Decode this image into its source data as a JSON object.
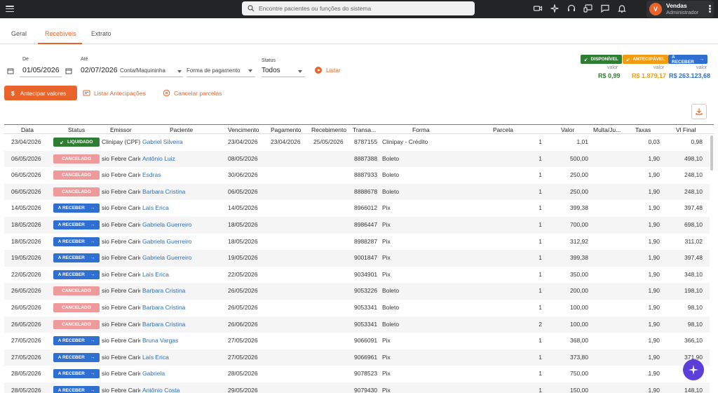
{
  "topbar": {
    "search_placeholder": "Encontre pacientes ou funções do sistema",
    "user_initial": "V",
    "user_name": "Vendas",
    "user_role": "Administrador"
  },
  "tabs": [
    {
      "label": "Geral"
    },
    {
      "label": "Recebíveis",
      "active": true
    },
    {
      "label": "Extrato"
    }
  ],
  "filters": {
    "de_label": "De",
    "de_value": "01/05/2026",
    "ate_label": "Até",
    "ate_value": "02/07/2026",
    "conta_label": "Conta/Maquininha",
    "forma_label": "Forma de pagamento",
    "status_label": "Status",
    "status_value": "Todos",
    "listar_label": "Listar"
  },
  "totals": [
    {
      "label": "DISPONÍVEL",
      "caption": "valor",
      "value": "R$ 0,99",
      "color": "#2e7d32"
    },
    {
      "label": "ANTECIPÁVEL",
      "caption": "valor",
      "value": "R$ 1.879,17",
      "color": "#f39c12"
    },
    {
      "label": "A RECEBER",
      "caption": "valor",
      "value": "R$ 263.123,68",
      "color": "#2f6fd0"
    }
  ],
  "actions": {
    "antecipar": "Antecipar valores",
    "listar_antecipacoes": "Listar Antecipações",
    "cancelar_parcelas": "Cancelar parcelas"
  },
  "columns": [
    "Data",
    "Status",
    "Emissor",
    "Paciente",
    "Vencimento",
    "Pagamento",
    "Recebimento",
    "Transa...",
    "Forma",
    "Parcela",
    "Valor",
    "Multa/Ju...",
    "Taxas",
    "Vl Final"
  ],
  "rows": [
    {
      "data": "23/04/2026",
      "status": "LIQUIDADO",
      "emissor": "Clinipay (CPF)",
      "paciente": "Gabriel Silveira",
      "vencimento": "23/04/2026",
      "pagamento": "23/04/2026",
      "recebimento": "25/05/2026",
      "transacao": "8787155",
      "forma": "Clinipay - Crédito",
      "parcela": "1",
      "valor": "1,01",
      "taxas": "0,03",
      "final": "0,98"
    },
    {
      "data": "06/05/2026",
      "status": "CANCELADO",
      "emissor": "sio Febre Carie",
      "paciente": "Antônio Luiz",
      "vencimento": "08/05/2026",
      "pagamento": "",
      "recebimento": "",
      "transacao": "8887388",
      "forma": "Boleto",
      "parcela": "1",
      "valor": "500,00",
      "taxas": "1,90",
      "final": "498,10"
    },
    {
      "data": "06/05/2026",
      "status": "CANCELADO",
      "emissor": "sio Febre Carie",
      "paciente": "Esdras",
      "vencimento": "30/06/2026",
      "pagamento": "",
      "recebimento": "",
      "transacao": "8887933",
      "forma": "Boleto",
      "parcela": "1",
      "valor": "250,00",
      "taxas": "1,90",
      "final": "248,10"
    },
    {
      "data": "06/05/2026",
      "status": "CANCELADO",
      "emissor": "sio Febre Carie",
      "paciente": "Barbara Cristina",
      "vencimento": "06/05/2026",
      "pagamento": "",
      "recebimento": "",
      "transacao": "8888678",
      "forma": "Boleto",
      "parcela": "1",
      "valor": "250,00",
      "taxas": "1,90",
      "final": "248,10"
    },
    {
      "data": "14/05/2026",
      "status": "A RECEBER",
      "emissor": "sio Febre Carie",
      "paciente": "Laís Erica",
      "vencimento": "14/05/2026",
      "pagamento": "",
      "recebimento": "",
      "transacao": "8966012",
      "forma": "Pix",
      "parcela": "1",
      "valor": "399,38",
      "taxas": "1,90",
      "final": "397,48"
    },
    {
      "data": "18/05/2026",
      "status": "A RECEBER",
      "emissor": "sio Febre Carie",
      "paciente": "Gabriela Guerreiro",
      "vencimento": "18/05/2026",
      "pagamento": "",
      "recebimento": "",
      "transacao": "8986447",
      "forma": "Pix",
      "parcela": "1",
      "valor": "700,00",
      "taxas": "1,90",
      "final": "698,10"
    },
    {
      "data": "18/05/2026",
      "status": "A RECEBER",
      "emissor": "sio Febre Carie",
      "paciente": "Gabriela Guerreiro",
      "vencimento": "18/05/2026",
      "pagamento": "",
      "recebimento": "",
      "transacao": "8988287",
      "forma": "Pix",
      "parcela": "1",
      "valor": "312,92",
      "taxas": "1,90",
      "final": "311,02"
    },
    {
      "data": "19/05/2026",
      "status": "A RECEBER",
      "emissor": "sio Febre Carie",
      "paciente": "Gabriela Guerreiro",
      "vencimento": "19/05/2026",
      "pagamento": "",
      "recebimento": "",
      "transacao": "9001847",
      "forma": "Pix",
      "parcela": "1",
      "valor": "399,38",
      "taxas": "1,90",
      "final": "397,48"
    },
    {
      "data": "22/05/2026",
      "status": "A RECEBER",
      "emissor": "sio Febre Carie",
      "paciente": "Laís Erica",
      "vencimento": "22/05/2026",
      "pagamento": "",
      "recebimento": "",
      "transacao": "9034901",
      "forma": "Pix",
      "parcela": "1",
      "valor": "350,00",
      "taxas": "1,90",
      "final": "348,10"
    },
    {
      "data": "26/05/2026",
      "status": "CANCELADO",
      "emissor": "sio Febre Carie",
      "paciente": "Barbara Cristina",
      "vencimento": "26/05/2026",
      "pagamento": "",
      "recebimento": "",
      "transacao": "9053226",
      "forma": "Boleto",
      "parcela": "1",
      "valor": "200,00",
      "taxas": "1,90",
      "final": "198,10"
    },
    {
      "data": "26/05/2026",
      "status": "CANCELADO",
      "emissor": "sio Febre Carie",
      "paciente": "Barbara Cristina",
      "vencimento": "26/05/2026",
      "pagamento": "",
      "recebimento": "",
      "transacao": "9053341",
      "forma": "Boleto",
      "parcela": "1",
      "valor": "100,00",
      "taxas": "1,90",
      "final": "98,10"
    },
    {
      "data": "26/05/2026",
      "status": "CANCELADO",
      "emissor": "sio Febre Carie",
      "paciente": "Barbara Cristina",
      "vencimento": "26/06/2026",
      "pagamento": "",
      "recebimento": "",
      "transacao": "9053341",
      "forma": "Boleto",
      "parcela": "2",
      "valor": "100,00",
      "taxas": "1,90",
      "final": "98,10"
    },
    {
      "data": "27/05/2026",
      "status": "A RECEBER",
      "emissor": "sio Febre Carie",
      "paciente": "Bruna Vargas",
      "vencimento": "27/05/2026",
      "pagamento": "",
      "recebimento": "",
      "transacao": "9066091",
      "forma": "Pix",
      "parcela": "1",
      "valor": "368,00",
      "taxas": "1,90",
      "final": "366,10"
    },
    {
      "data": "27/05/2026",
      "status": "A RECEBER",
      "emissor": "sio Febre Carie",
      "paciente": "Laís Erica",
      "vencimento": "27/05/2026",
      "pagamento": "",
      "recebimento": "",
      "transacao": "9066961",
      "forma": "Pix",
      "parcela": "1",
      "valor": "373,80",
      "taxas": "1,90",
      "final": "371,90"
    },
    {
      "data": "28/05/2026",
      "status": "A RECEBER",
      "emissor": "sio Febre Carie",
      "paciente": "Gabriela",
      "vencimento": "28/05/2026",
      "pagamento": "",
      "recebimento": "",
      "transacao": "9078523",
      "forma": "Pix",
      "parcela": "1",
      "valor": "750,00",
      "taxas": "1,90",
      "final": "748,10"
    },
    {
      "data": "28/05/2026",
      "status": "A RECEBER",
      "emissor": "sio Febre Carie",
      "paciente": "Antônio Costa",
      "vencimento": "29/05/2026",
      "pagamento": "",
      "recebimento": "",
      "transacao": "9079430",
      "forma": "Pix",
      "parcela": "1",
      "valor": "150,00",
      "taxas": "1,90",
      "final": "148,10"
    }
  ]
}
